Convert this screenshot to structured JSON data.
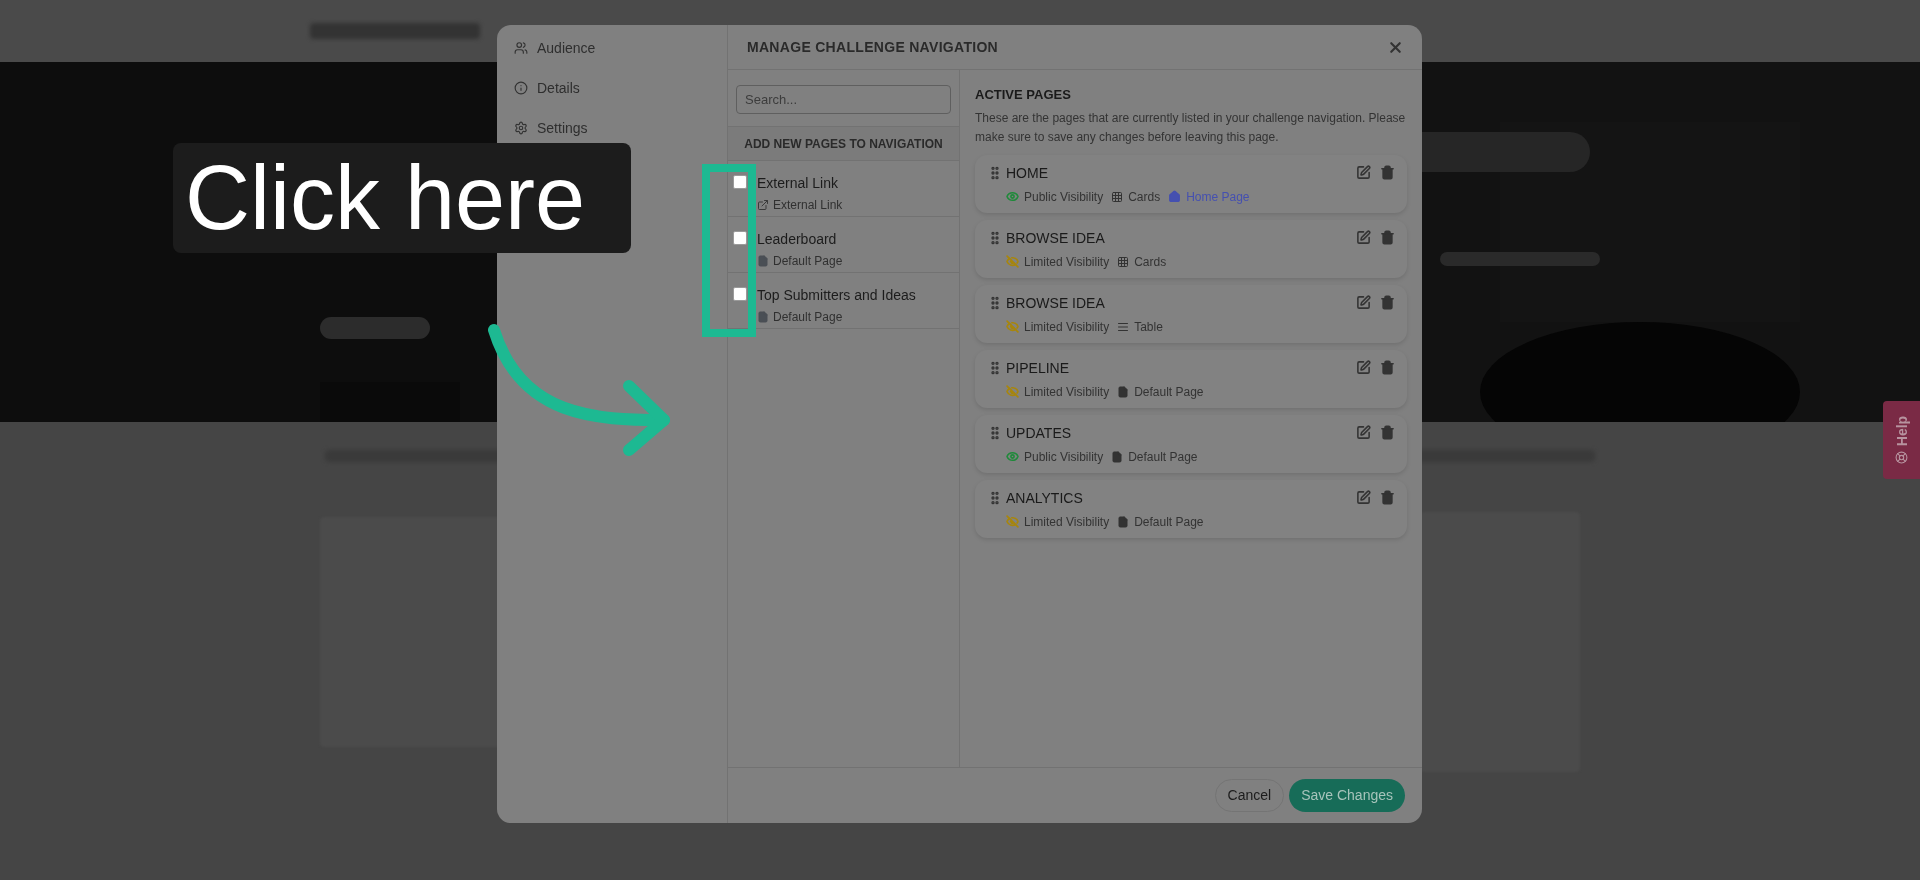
{
  "callout": {
    "text": "Click here"
  },
  "help_tab": {
    "label": "Help"
  },
  "dialog": {
    "title": "MANAGE CHALLENGE NAVIGATION",
    "sidebar": {
      "items": [
        {
          "label": "Audience",
          "kind": "audience"
        },
        {
          "label": "Details",
          "kind": "details"
        },
        {
          "label": "Settings",
          "kind": "settings"
        }
      ]
    },
    "search": {
      "placeholder": "Search..."
    },
    "available": {
      "heading": "ADD NEW PAGES TO NAVIGATION",
      "items": [
        {
          "title": "External Link",
          "subtitle": "External Link",
          "kind": "link",
          "checked": false
        },
        {
          "title": "Leaderboard",
          "subtitle": "Default Page",
          "kind": "page",
          "checked": false
        },
        {
          "title": "Top Submitters and Ideas",
          "subtitle": "Default Page",
          "kind": "page",
          "checked": false
        }
      ]
    },
    "active": {
      "heading": "ACTIVE PAGES",
      "description": "These are the pages that are currently listed in your challenge navigation. Please make sure to save any changes before leaving this page.",
      "pages": [
        {
          "title": "HOME",
          "visibility": {
            "kind": "public",
            "label": "Public Visibility"
          },
          "layout": {
            "kind": "cards",
            "label": "Cards"
          },
          "home": "Home Page"
        },
        {
          "title": "BROWSE IDEA",
          "visibility": {
            "kind": "limited",
            "label": "Limited Visibility"
          },
          "layout": {
            "kind": "cards",
            "label": "Cards"
          }
        },
        {
          "title": "BROWSE IDEA",
          "visibility": {
            "kind": "limited",
            "label": "Limited Visibility"
          },
          "layout": {
            "kind": "table",
            "label": "Table"
          }
        },
        {
          "title": "PIPELINE",
          "visibility": {
            "kind": "limited",
            "label": "Limited Visibility"
          },
          "layout": {
            "kind": "default",
            "label": "Default Page"
          }
        },
        {
          "title": "UPDATES",
          "visibility": {
            "kind": "public",
            "label": "Public Visibility"
          },
          "layout": {
            "kind": "default",
            "label": "Default Page"
          }
        },
        {
          "title": "ANALYTICS",
          "visibility": {
            "kind": "limited",
            "label": "Limited Visibility"
          },
          "layout": {
            "kind": "default",
            "label": "Default Page"
          }
        }
      ]
    },
    "buttons": {
      "cancel": "Cancel",
      "save": "Save Changes"
    }
  }
}
